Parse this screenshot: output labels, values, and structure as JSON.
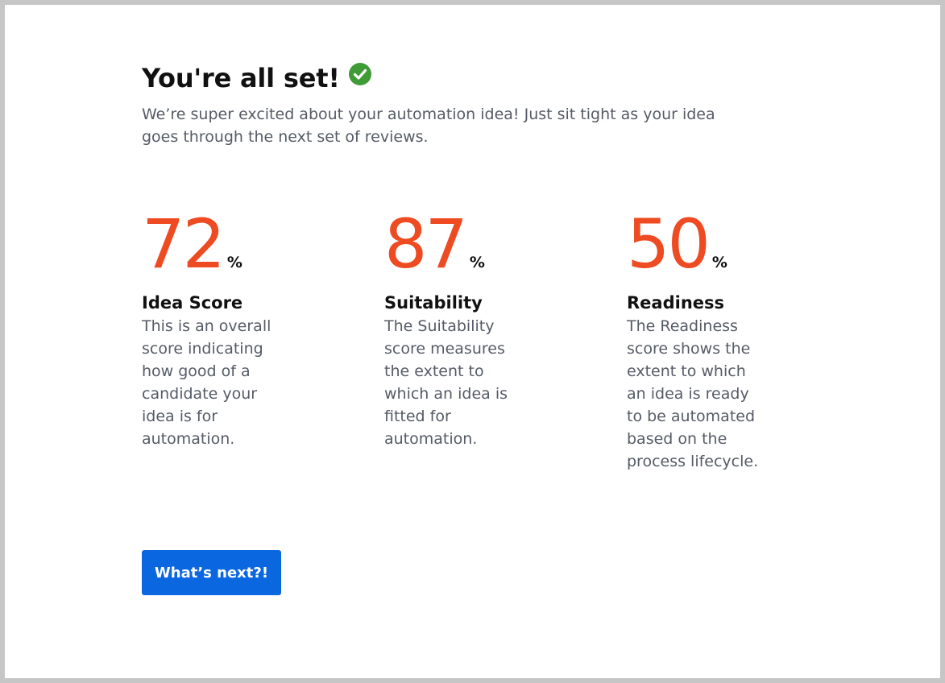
{
  "header": {
    "title": "You're all set!",
    "title_icon": "check-circle-icon",
    "subtitle": "We’re super excited about your automation idea! Just sit tight as your idea goes through the next set of reviews."
  },
  "metrics": [
    {
      "value": "72",
      "unit": "%",
      "label": "Idea Score",
      "description": "This is an overall score indicating how good of a candidate your idea is for automation."
    },
    {
      "value": "87",
      "unit": "%",
      "label": "Suitability",
      "description": "The Suitability score measures the extent to which an idea is fitted for automation."
    },
    {
      "value": "50",
      "unit": "%",
      "label": "Readiness",
      "description": "The Readiness score shows the extent to which an idea is ready to be automated based on the process lifecycle."
    }
  ],
  "actions": {
    "next_label": "What’s next?!"
  },
  "colors": {
    "accent": "#ee4b22",
    "button": "#0a67e0",
    "success": "#3f9b35",
    "text_primary": "#111111",
    "text_secondary": "#555b66"
  }
}
